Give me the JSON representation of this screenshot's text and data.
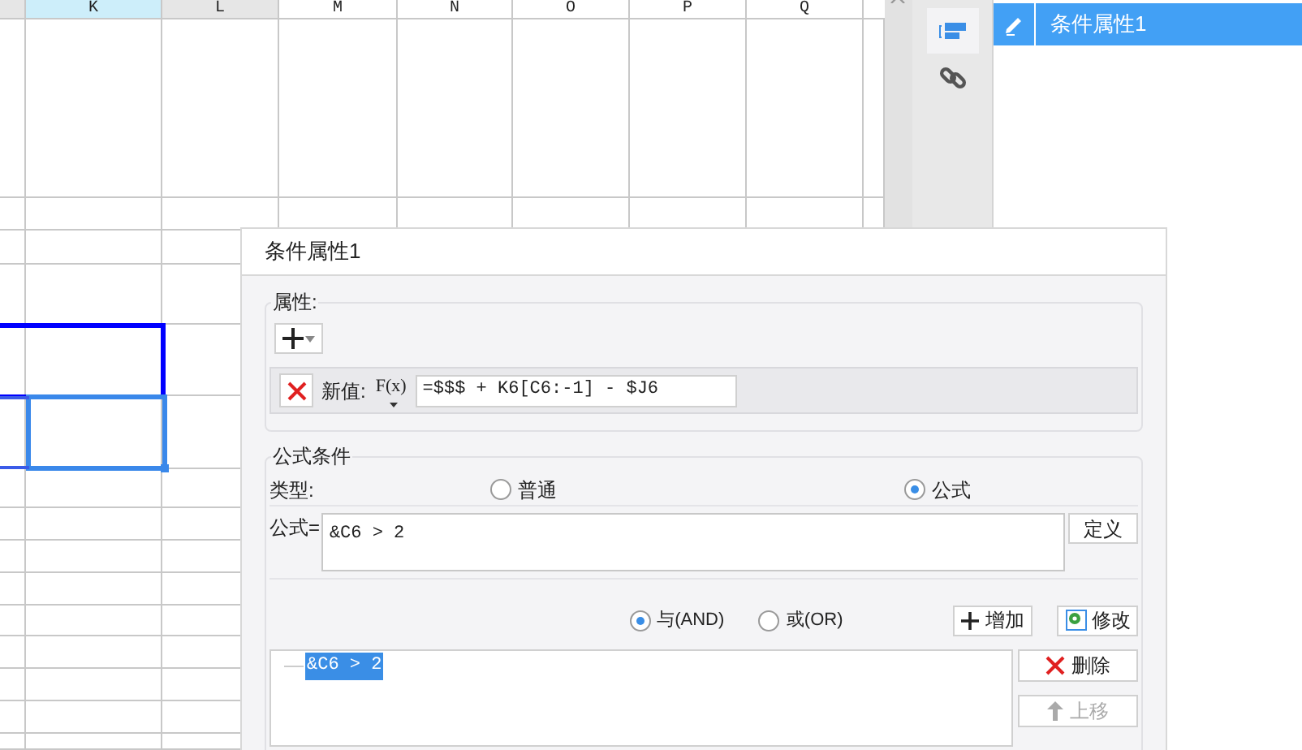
{
  "sheet": {
    "columns": [
      {
        "label": "K",
        "selected": true
      },
      {
        "label": "L",
        "selected": false
      },
      {
        "label": "M",
        "selected": false
      },
      {
        "label": "N",
        "selected": false
      },
      {
        "label": "O",
        "selected": false
      },
      {
        "label": "P",
        "selected": false
      },
      {
        "label": "Q",
        "selected": false
      }
    ]
  },
  "side_panel": {
    "items": [
      {
        "label": "条件属性1",
        "selected": true
      }
    ]
  },
  "dialog": {
    "title": "条件属性1",
    "attributes": {
      "legend": "属性:",
      "rows": [
        {
          "label": "新值:",
          "formula_icon": "F(x)",
          "value": "=$$$ + K6[C6:-1] - $J6"
        }
      ]
    },
    "condition": {
      "legend": "公式条件",
      "type_label": "类型:",
      "types": [
        {
          "label": "普通",
          "selected": false
        },
        {
          "label": "公式",
          "selected": true
        }
      ],
      "formula_label": "公式=",
      "formula": "&C6 > 2",
      "define_button": "定义",
      "joins": [
        {
          "label": "与(AND)",
          "selected": true
        },
        {
          "label": "或(OR)",
          "selected": false
        }
      ],
      "add_button": "增加",
      "modify_button": "修改",
      "list": [
        {
          "label": "&C6 > 2",
          "selected": true
        }
      ],
      "side_buttons": [
        {
          "label": "删除",
          "kind": "delete",
          "disabled": false
        },
        {
          "label": "上移",
          "kind": "up",
          "disabled": true
        }
      ]
    }
  }
}
